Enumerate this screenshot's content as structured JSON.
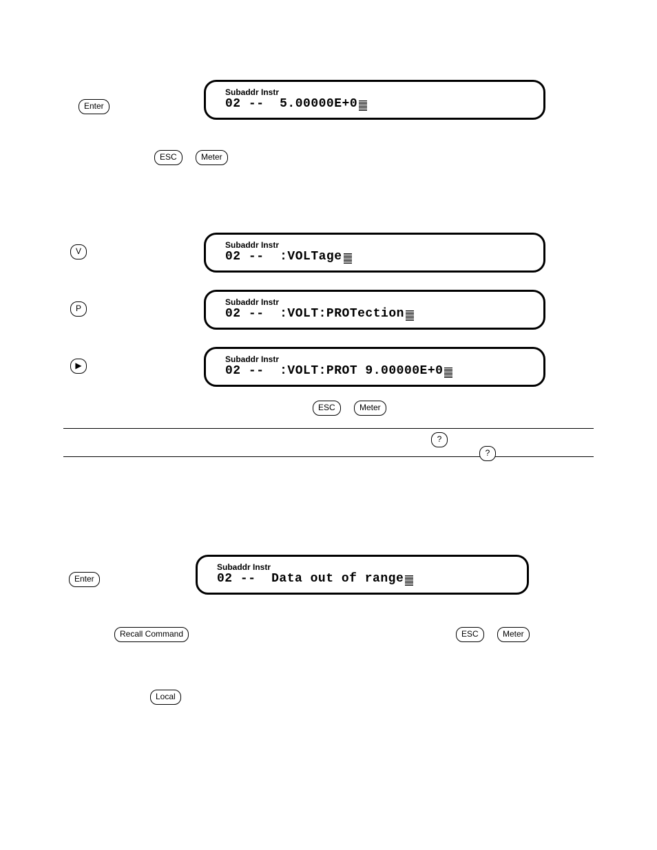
{
  "keys": {
    "enter": "Enter",
    "esc": "ESC",
    "meter": "Meter",
    "recall": "Recall Command",
    "local": "Local",
    "v": "V",
    "p": "P",
    "play": "▶",
    "q": "?"
  },
  "lcd_title": "Subaddr Instr",
  "lcd": {
    "line1": "02 --  5.00000E+0",
    "line2": "02 --  :VOLTage",
    "line3": "02 --  :VOLT:PROTection",
    "line4": "02 --  :VOLT:PROT 9.00000E+0",
    "line5": "02 --  Data out of range"
  }
}
